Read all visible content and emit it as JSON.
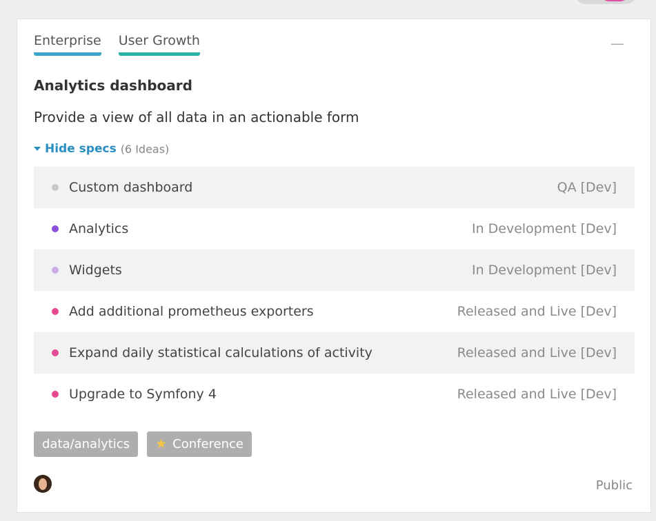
{
  "card": {
    "tabs": [
      {
        "label": "Enterprise",
        "color": "#3aa7c8"
      },
      {
        "label": "User Growth",
        "color": "#28b3a6"
      }
    ],
    "collapse_icon": "minus-icon",
    "title": "Analytics dashboard",
    "description": "Provide a view of all data in an actionable form",
    "specs_toggle": {
      "label": "Hide specs",
      "count": "(6 Ideas)"
    },
    "specs": [
      {
        "name": "Custom dashboard",
        "status": "QA [Dev]",
        "dot_color": "#c8c8c8"
      },
      {
        "name": "Analytics",
        "status": "In Development [Dev]",
        "dot_color": "#8a4fd8"
      },
      {
        "name": "Widgets",
        "status": "In Development [Dev]",
        "dot_color": "#c9aee8"
      },
      {
        "name": "Add additional prometheus exporters",
        "status": "Released and Live [Dev]",
        "dot_color": "#e5498f"
      },
      {
        "name": "Expand daily statistical calculations of activity",
        "status": "Released and Live [Dev]",
        "dot_color": "#e5498f"
      },
      {
        "name": "Upgrade to Symfony 4",
        "status": "Released and Live [Dev]",
        "dot_color": "#e5498f"
      }
    ],
    "tags": [
      {
        "label": "data/analytics"
      },
      {
        "label": "Conference",
        "icon": "star-icon"
      }
    ],
    "avatar_icon": "user-avatar",
    "visibility": "Public"
  }
}
